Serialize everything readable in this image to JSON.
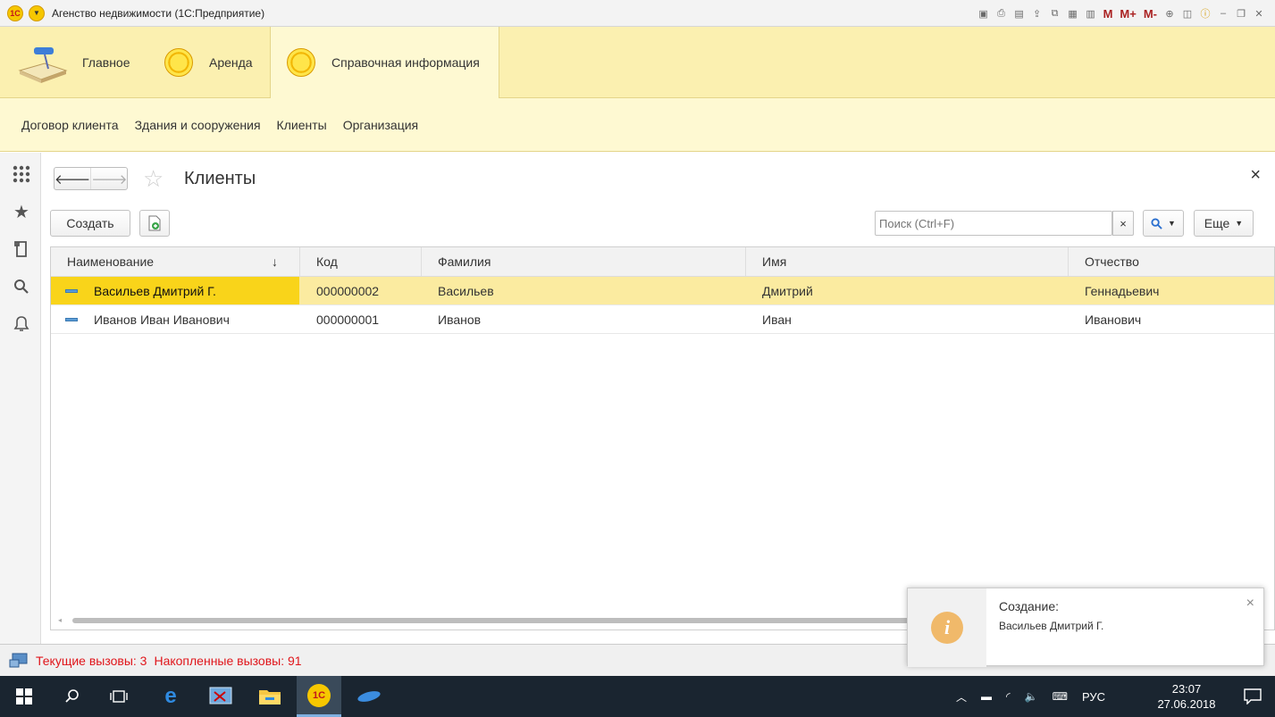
{
  "window": {
    "title": "Агенство недвижимости  (1С:Предприятие)",
    "logo": "1С"
  },
  "sections": [
    {
      "label": "Главное",
      "icon": "desk-lamp-icon"
    },
    {
      "label": "Аренда",
      "icon": "coin-icon"
    },
    {
      "label": "Справочная информация",
      "icon": "coin-icon",
      "active": true
    }
  ],
  "subnav": [
    "Договор клиента",
    "Здания и сооружения",
    "Клиенты",
    "Организация"
  ],
  "form": {
    "title": "Клиенты",
    "create_label": "Создать",
    "search_placeholder": "Поиск (Ctrl+F)",
    "more_label": "Еще",
    "clear_symbol": "×",
    "close_symbol": "×"
  },
  "table": {
    "columns": [
      "Наименование",
      "Код",
      "Фамилия",
      "Имя",
      "Отчество"
    ],
    "sort_indicator": "↓",
    "rows": [
      {
        "name": "Васильев Дмитрий Г.",
        "code": "000000002",
        "last": "Васильев",
        "first": "Дмитрий",
        "middle": "Геннадьевич",
        "selected": true
      },
      {
        "name": "Иванов Иван Иванович",
        "code": "000000001",
        "last": "Иванов",
        "first": "Иван",
        "middle": "Иванович",
        "selected": false
      }
    ]
  },
  "status": {
    "current_calls": "Текущие вызовы: 3",
    "accumulated_calls": "Накопленные вызовы: 91"
  },
  "notification": {
    "title": "Создание:",
    "text": "Васильев Дмитрий Г."
  },
  "taskbar": {
    "lang": "РУС",
    "time": "23:07",
    "date": "27.06.2018"
  },
  "colors": {
    "section_bg": "#fbf0b0",
    "selection": "#f9d41a",
    "row_selected": "#fbeba0",
    "status_text": "#e0161b"
  }
}
